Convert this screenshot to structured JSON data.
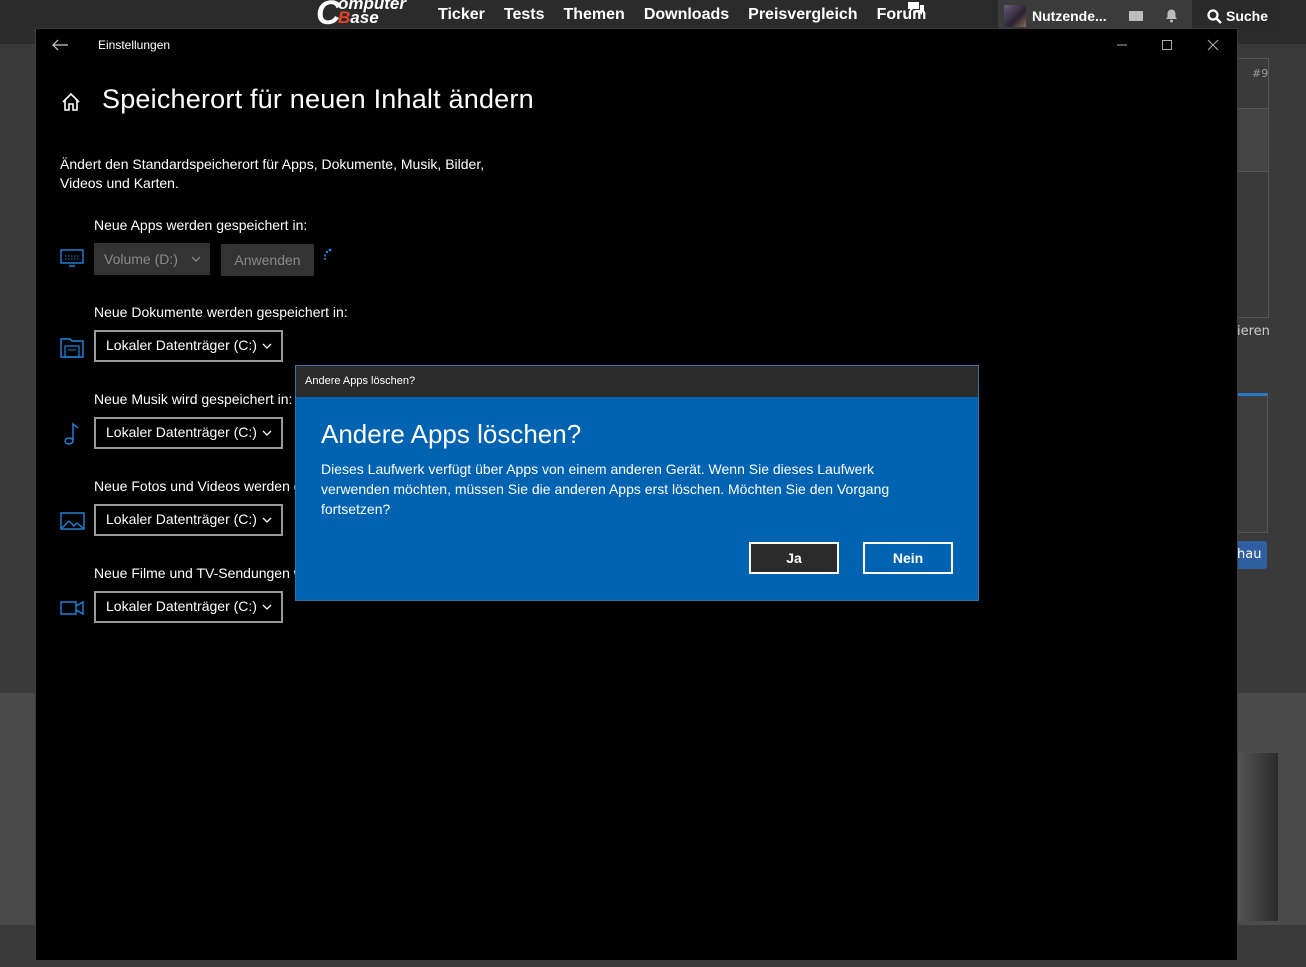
{
  "website": {
    "logo": {
      "line1": "omputer",
      "line2": "ase"
    },
    "nav": [
      "Ticker",
      "Tests",
      "Themen",
      "Downloads",
      "Preisvergleich",
      "Forum"
    ],
    "user_name": "Nutzende...",
    "search_label": "Suche",
    "post_number": "#9",
    "side_text": "ieren",
    "side_button": "hau"
  },
  "window": {
    "title": "Einstellungen",
    "page_title": "Speicherort für neuen Inhalt ändern",
    "description": "Ändert den Standardspeicherort für Apps, Dokumente, Musik, Bilder, Videos und Karten.",
    "apps": {
      "label": "Neue Apps werden gespeichert in:",
      "value": "Volume (D:)",
      "apply": "Anwenden"
    },
    "documents": {
      "label": "Neue Dokumente werden gespeichert in:",
      "value": "Lokaler Datenträger (C:)"
    },
    "music": {
      "label": "Neue Musik wird gespeichert in:",
      "value": "Lokaler Datenträger (C:)"
    },
    "photos": {
      "label": "Neue Fotos und Videos werden g",
      "value": "Lokaler Datenträger (C:)"
    },
    "movies": {
      "label": "Neue Filme und TV-Sendungen w",
      "value": "Lokaler Datenträger (C:)"
    }
  },
  "dialog": {
    "bar_title": "Andere Apps löschen?",
    "title": "Andere Apps löschen?",
    "text": "Dieses Laufwerk verfügt über Apps von einem anderen Gerät. Wenn Sie dieses Laufwerk verwenden möchten, müssen Sie die anderen Apps erst löschen. Möchten Sie den Vorgang fortsetzen?",
    "yes": "Ja",
    "no": "Nein"
  },
  "colors": {
    "accent": "#0063b1",
    "icon_blue": "#1e88e5",
    "brand_red": "#e8412c"
  }
}
